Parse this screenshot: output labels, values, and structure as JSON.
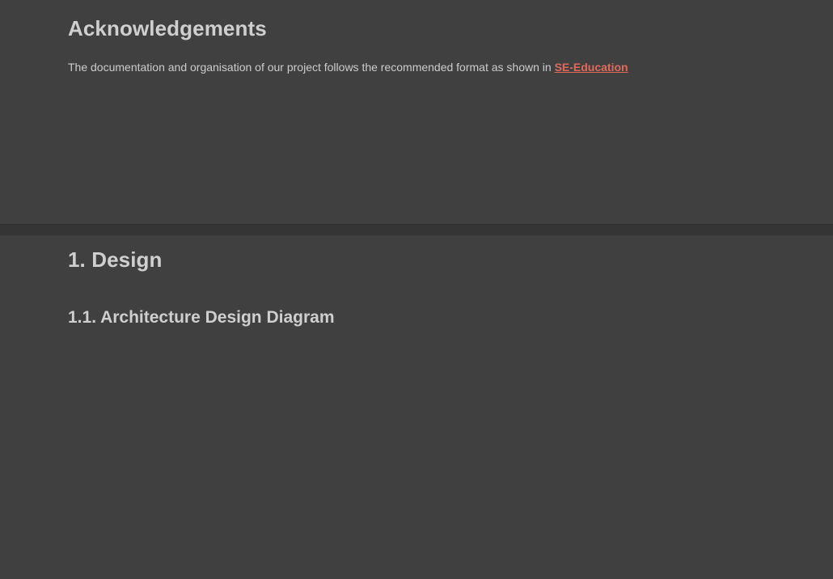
{
  "acknowledgements": {
    "title": "Acknowledgements",
    "text": "The documentation and organisation of our project follows the recommended format as shown in ",
    "link_label": "SE-Education"
  },
  "design": {
    "title": "1. Design",
    "subsection_title": "1.1. Architecture Design Diagram"
  },
  "colors": {
    "background": "#404040",
    "heading": "#cfcfcf",
    "body_text": "#cccccc",
    "link": "#e06a5a"
  }
}
